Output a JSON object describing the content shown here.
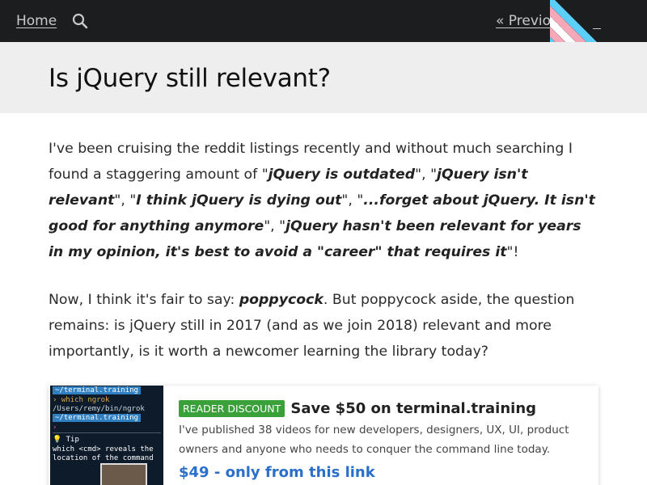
{
  "nav": {
    "home_label": "Home",
    "previous_label": "« Previous"
  },
  "icons": {
    "search": "search-icon",
    "flag": "trans-flag-corner"
  },
  "colors": {
    "topbar_bg": "#1c1d1f",
    "title_band_bg": "#eeeeee",
    "badge_bg": "#3aa13a",
    "price_link": "#2a6fc9",
    "flag_blue": "#5bcefa",
    "flag_pink": "#f5a9b8",
    "flag_white": "#ffffff"
  },
  "article": {
    "title": "Is jQuery still relevant?",
    "p1": {
      "t1": "I've been cruising the reddit listings recently and without much searching I found a staggering amount of \"",
      "q1": "jQuery is outdated",
      "t2": "\", \"",
      "q2": "jQuery isn't relevant",
      "t3": "\", \"",
      "q3": "I think jQuery is dying out",
      "t4": "\", \"",
      "q4": "...forget about jQuery. It isn't good for anything anymore",
      "t5": "\", \"",
      "q5": "jQuery hasn't been relevant for years in my opinion, it's best to avoid a \"career\" that requires it",
      "t6": "\"!"
    },
    "p2": {
      "t1": "Now, I think it's fair to say: ",
      "q1": "poppycock",
      "t2": ". But poppycock aside, the question remains: is jQuery still in 2017 (and as we join 2018) relevant and more importantly, is it worth a newcomer learning the library today?"
    }
  },
  "ad": {
    "badge": "READER DISCOUNT",
    "title": "Save $50 on terminal.training",
    "description": "I've published 38 videos for new developers, designers, UX, UI, product owners and anyone who needs to conquer the command line today.",
    "price_link": "$49 - only from this link",
    "thumb": {
      "line1": "~/terminal.training",
      "line2": "› which ngrok",
      "line3": "/Users/remy/bin/ngrok",
      "line4": "~/terminal.training",
      "line5": "›",
      "line6": "Tip",
      "line7": "which <cmd> reveals the",
      "line8": "location of the command"
    }
  }
}
